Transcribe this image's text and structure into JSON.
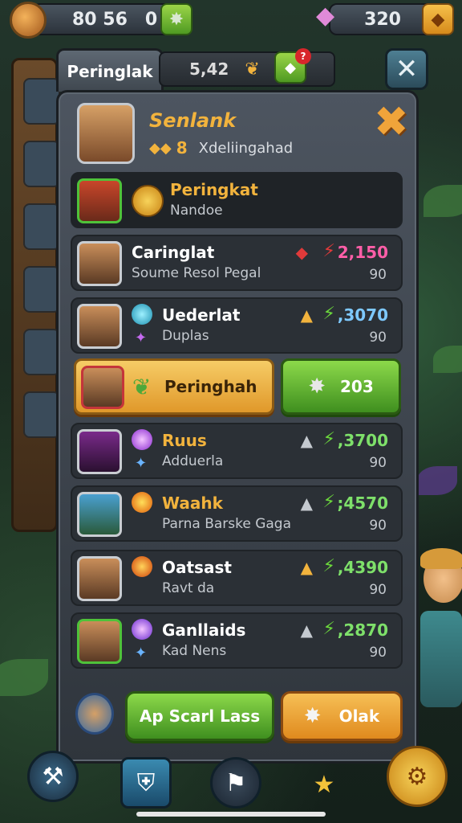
{
  "topbar": {
    "resources": "80 56",
    "zero": "0",
    "gold": "320"
  },
  "tab": {
    "label": "Peringlak",
    "count": "5,42",
    "badge": "?"
  },
  "header": {
    "name": "Senlank",
    "level": "8",
    "subtitle": "Xdeliingahad"
  },
  "rank_row": {
    "title": "Peringkat",
    "subtitle": "Nandoe"
  },
  "rows": [
    {
      "name": "Caringlat",
      "sub": "Soume Resol Pegal",
      "score": "2,150",
      "points": "90",
      "score_color": "#ff5ea8"
    },
    {
      "name": "Uederlat",
      "sub": "Duplas",
      "score": ",3070",
      "points": "90",
      "score_color": "#7ec9ff"
    },
    {
      "name": "Ruus",
      "sub": "Adduerla",
      "score": ",3700",
      "points": "90",
      "score_color": "#7ee06a"
    },
    {
      "name": "Waahk",
      "sub": "Parna Barske Gaga",
      "score": ";4570",
      "points": "90",
      "score_color": "#7ee06a"
    },
    {
      "name": "Oatsast",
      "sub": "Ravt da",
      "score": ",4390",
      "points": "90",
      "score_color": "#7ee06a"
    },
    {
      "name": "Ganllaids",
      "sub": "Kad Nens",
      "score": ",2870",
      "points": "90",
      "score_color": "#7ee06a"
    }
  ],
  "highlight": {
    "name": "Peringhah",
    "value": "203"
  },
  "footer": {
    "primary": "Ap Scarl Lass",
    "secondary": "Olak"
  }
}
